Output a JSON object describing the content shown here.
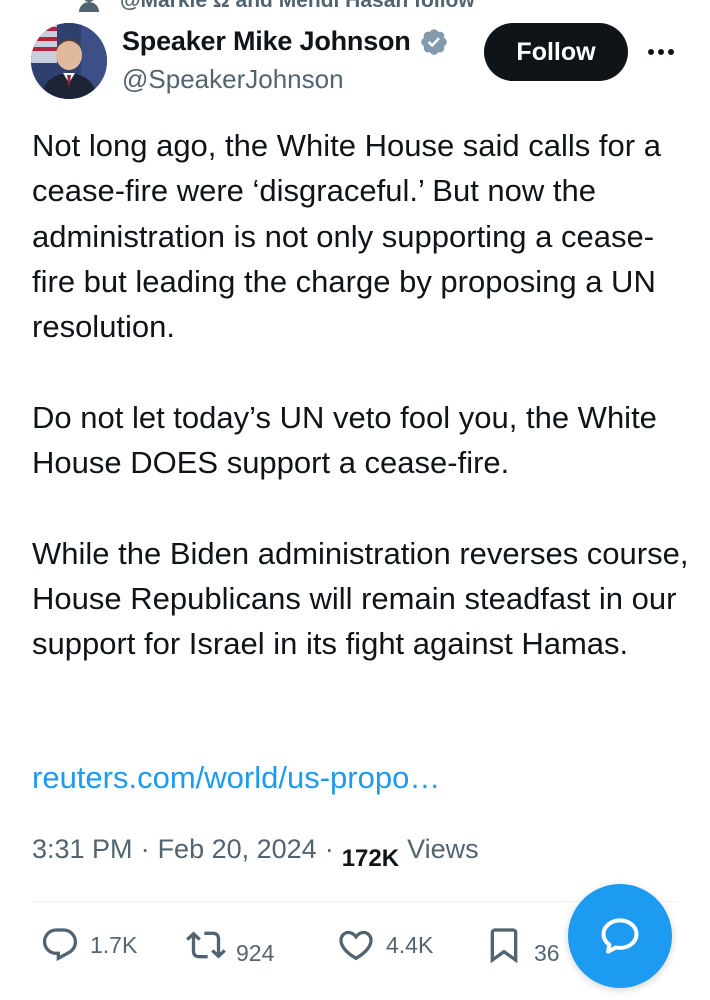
{
  "social_context": {
    "text": "@Markie Ω and Mehdi Hasan follow",
    "icon": "person-icon"
  },
  "author": {
    "display_name": "Speaker Mike Johnson",
    "handle": "@SpeakerJohnson",
    "verified_icon": "verified-badge-icon",
    "verified_color": "#829aab"
  },
  "header": {
    "follow_label": "Follow",
    "more_icon": "more-horizontal-icon"
  },
  "tweet": {
    "paragraphs": [
      "Not long ago, the White House said calls for a cease-fire were ‘disgraceful.’ But now the administration is not only supporting a cease-fire but leading the charge by proposing a UN resolution.",
      "Do not let today’s UN veto fool you, the White House DOES support a cease-fire.",
      "While the Biden administration reverses course, House Republicans will remain steadfast in our support for Israel in its fight against Hamas."
    ],
    "link": "reuters.com/world/us-propo…",
    "time": "3:31 PM",
    "date": "Feb 20, 2024",
    "separator": "·",
    "views_count": "172K",
    "views_label": "Views"
  },
  "actions": {
    "reply": {
      "icon": "reply-icon",
      "count": "1.7K"
    },
    "retweet": {
      "icon": "retweet-icon",
      "count": "924"
    },
    "like": {
      "icon": "heart-icon",
      "count": "4.4K"
    },
    "bookmark": {
      "icon": "bookmark-icon",
      "count": "36"
    }
  },
  "fab": {
    "icon": "message-bubble-icon"
  },
  "colors": {
    "text": "#0f1419",
    "secondary": "#536471",
    "accent": "#1d9bf0",
    "button_bg": "#0f1419"
  }
}
